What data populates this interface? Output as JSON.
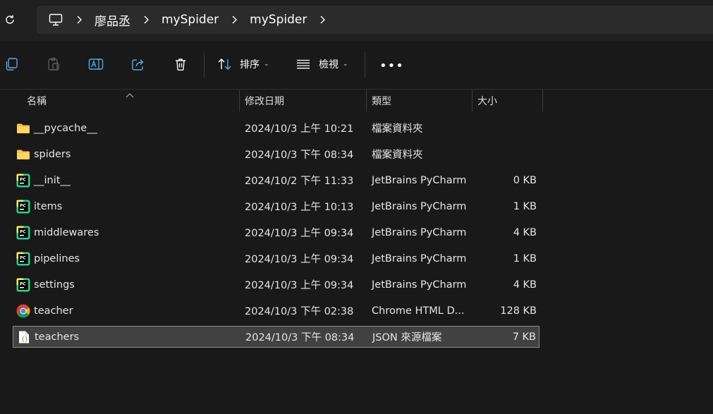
{
  "nav": {
    "refresh_icon": "refresh-icon",
    "computer_icon": "computer-icon",
    "breadcrumb": [
      "廖品丞",
      "mySpider",
      "mySpider"
    ]
  },
  "toolbar": {
    "copy_icon": "copy-icon",
    "paste_icon": "paste-icon",
    "rename_icon": "rename-icon",
    "share_icon": "share-icon",
    "delete_icon": "trash-icon",
    "sort_label": "排序",
    "view_label": "檢視",
    "more_label": "•••"
  },
  "columns": {
    "name": "名稱",
    "modified": "修改日期",
    "type": "類型",
    "size": "大小"
  },
  "files": [
    {
      "name": "__pycache__",
      "modified": "2024/10/3 上午 10:21",
      "type": "檔案資料夾",
      "size": "",
      "icon": "folder-icon"
    },
    {
      "name": "spiders",
      "modified": "2024/10/3 下午 08:34",
      "type": "檔案資料夾",
      "size": "",
      "icon": "folder-icon"
    },
    {
      "name": "__init__",
      "modified": "2024/10/2 下午 11:33",
      "type": "JetBrains PyCharm",
      "size": "0 KB",
      "icon": "pycharm-icon"
    },
    {
      "name": "items",
      "modified": "2024/10/3 上午 10:13",
      "type": "JetBrains PyCharm",
      "size": "1 KB",
      "icon": "pycharm-icon"
    },
    {
      "name": "middlewares",
      "modified": "2024/10/3 上午 09:34",
      "type": "JetBrains PyCharm",
      "size": "4 KB",
      "icon": "pycharm-icon"
    },
    {
      "name": "pipelines",
      "modified": "2024/10/3 上午 09:34",
      "type": "JetBrains PyCharm",
      "size": "1 KB",
      "icon": "pycharm-icon"
    },
    {
      "name": "settings",
      "modified": "2024/10/3 上午 09:34",
      "type": "JetBrains PyCharm",
      "size": "4 KB",
      "icon": "pycharm-icon"
    },
    {
      "name": "teacher",
      "modified": "2024/10/3 下午 02:38",
      "type": "Chrome HTML D...",
      "size": "128 KB",
      "icon": "chrome-icon"
    },
    {
      "name": "teachers",
      "modified": "2024/10/3 下午 08:34",
      "type": "JSON 來源檔案",
      "size": "7 KB",
      "icon": "json-file-icon",
      "selected": true
    }
  ]
}
